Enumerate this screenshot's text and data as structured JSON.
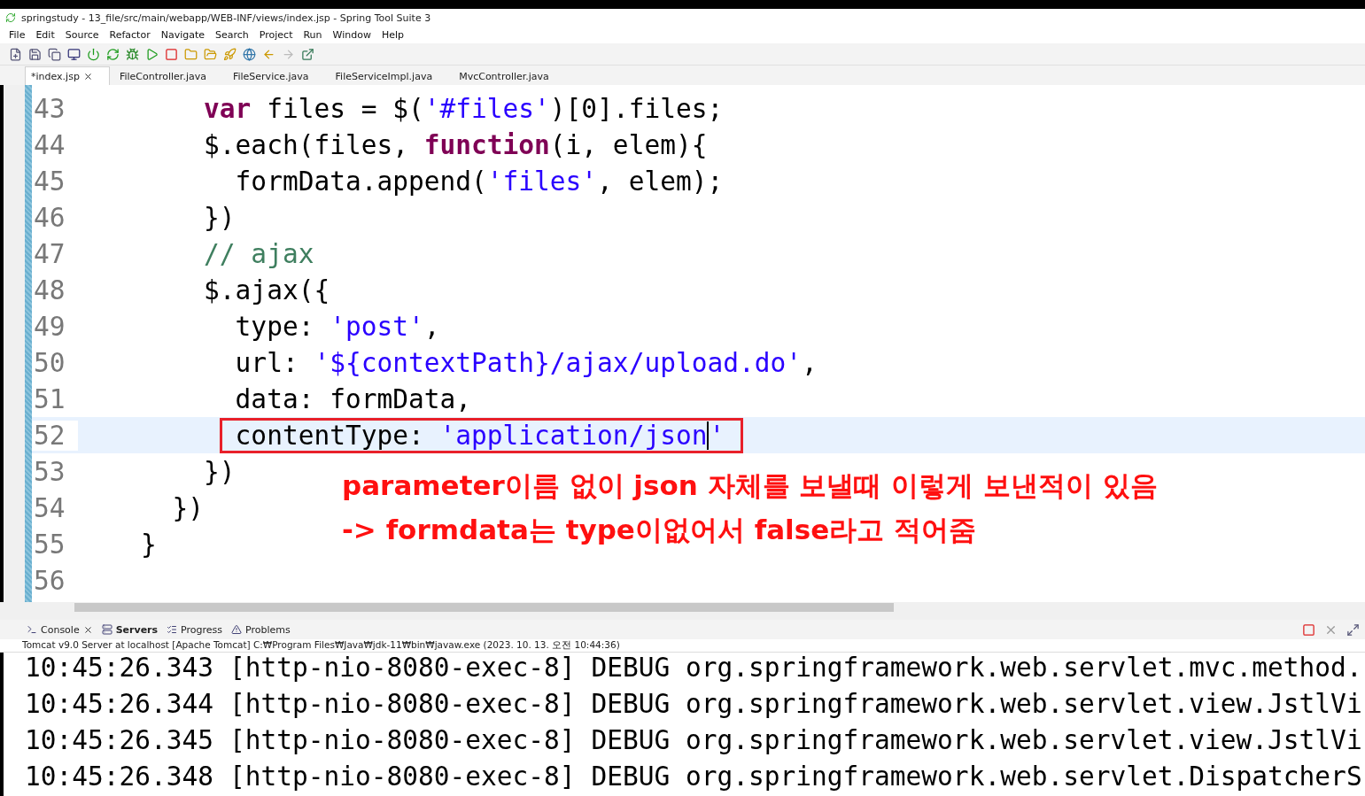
{
  "window": {
    "title": "springstudy - 13_file/src/main/webapp/WEB-INF/views/index.jsp - Spring Tool Suite 3"
  },
  "menu": [
    "File",
    "Edit",
    "Source",
    "Refactor",
    "Navigate",
    "Search",
    "Project",
    "Run",
    "Window",
    "Help"
  ],
  "editor_tabs": [
    {
      "label": "*index.jsp",
      "selected": true,
      "closable": true
    },
    {
      "label": "FileController.java",
      "selected": false,
      "closable": false
    },
    {
      "label": "FileService.java",
      "selected": false,
      "closable": false
    },
    {
      "label": "FileServiceImpl.java",
      "selected": false,
      "closable": false
    },
    {
      "label": "MvcController.java",
      "selected": false,
      "closable": false
    }
  ],
  "code": [
    {
      "number": "43",
      "current": false,
      "tokens": [
        {
          "kind": "keyword",
          "text": "        var"
        },
        {
          "kind": "plain",
          "text": " files = $("
        },
        {
          "kind": "string",
          "text": "'#files'"
        },
        {
          "kind": "plain",
          "text": ")[0].files;"
        }
      ]
    },
    {
      "number": "44",
      "current": false,
      "tokens": [
        {
          "kind": "plain",
          "text": "        $.each(files, "
        },
        {
          "kind": "keyword",
          "text": "function"
        },
        {
          "kind": "plain",
          "text": "(i, elem){"
        }
      ]
    },
    {
      "number": "45",
      "current": false,
      "tokens": [
        {
          "kind": "plain",
          "text": "          formData.append("
        },
        {
          "kind": "string",
          "text": "'files'"
        },
        {
          "kind": "plain",
          "text": ", elem);"
        }
      ]
    },
    {
      "number": "46",
      "current": false,
      "tokens": [
        {
          "kind": "plain",
          "text": "        })"
        }
      ]
    },
    {
      "number": "47",
      "current": false,
      "tokens": [
        {
          "kind": "comment",
          "text": "        // ajax"
        }
      ]
    },
    {
      "number": "48",
      "current": false,
      "tokens": [
        {
          "kind": "plain",
          "text": "        $.ajax({"
        }
      ]
    },
    {
      "number": "49",
      "current": false,
      "tokens": [
        {
          "kind": "plain",
          "text": "          type: "
        },
        {
          "kind": "string",
          "text": "'post'"
        },
        {
          "kind": "plain",
          "text": ","
        }
      ]
    },
    {
      "number": "50",
      "current": false,
      "tokens": [
        {
          "kind": "plain",
          "text": "          url: "
        },
        {
          "kind": "string",
          "text": "'${contextPath}/ajax/upload.do'"
        },
        {
          "kind": "plain",
          "text": ","
        }
      ]
    },
    {
      "number": "51",
      "current": false,
      "tokens": [
        {
          "kind": "plain",
          "text": "          data: formData,"
        }
      ]
    },
    {
      "number": "52",
      "current": true,
      "boxed": true,
      "tokens": [
        {
          "kind": "plain",
          "text": "          contentType: "
        },
        {
          "kind": "string",
          "text": "'application/json"
        },
        {
          "kind": "cursor"
        },
        {
          "kind": "string",
          "text": "'"
        }
      ]
    },
    {
      "number": "53",
      "current": false,
      "tokens": [
        {
          "kind": "plain",
          "text": "        })"
        }
      ]
    },
    {
      "number": "54",
      "current": false,
      "tokens": [
        {
          "kind": "plain",
          "text": "      })"
        }
      ]
    },
    {
      "number": "55",
      "current": false,
      "tokens": [
        {
          "kind": "plain",
          "text": "    }"
        }
      ]
    },
    {
      "number": "56",
      "current": false
    }
  ],
  "annotation": [
    "parameter이름 없이 json 자체를 보낼때 이렇게 보낸적이 있음",
    "-> formdata는 type이없어서 false라고 적어줌"
  ],
  "console_tabs": [
    {
      "label": "Console",
      "selected": false,
      "closable": true
    },
    {
      "label": "Servers",
      "selected": true,
      "closable": false
    },
    {
      "label": "Progress",
      "selected": false,
      "closable": false
    },
    {
      "label": "Problems",
      "selected": false,
      "closable": false
    }
  ],
  "console_status": "Tomcat v9.0 Server at localhost [Apache Tomcat] C:₩Program Files₩Java₩jdk-11₩bin₩javaw.exe  (2023. 10. 13. 오전 10:44:36)",
  "console_lines": [
    "10:45:26.343 [http-nio-8080-exec-8] DEBUG org.springframework.web.servlet.mvc.method.",
    "10:45:26.344 [http-nio-8080-exec-8] DEBUG org.springframework.web.servlet.view.JstlVi",
    "10:45:26.345 [http-nio-8080-exec-8] DEBUG org.springframework.web.servlet.view.JstlVi",
    "10:45:26.348 [http-nio-8080-exec-8] DEBUG org.springframework.web.servlet.DispatcherS"
  ]
}
